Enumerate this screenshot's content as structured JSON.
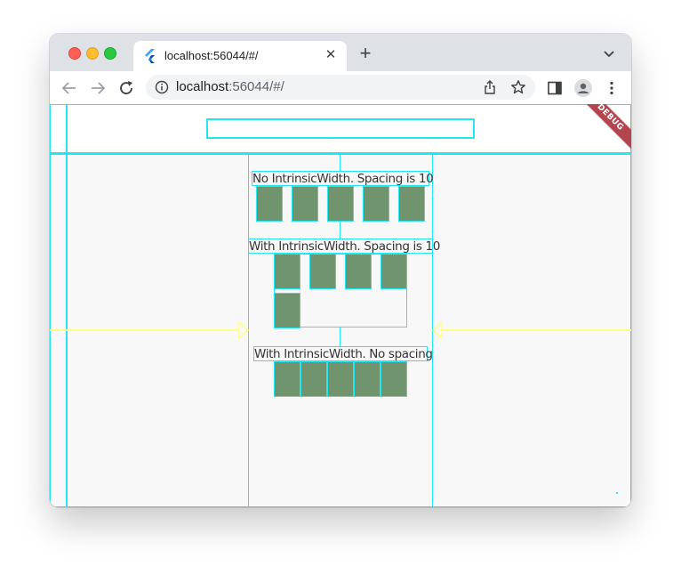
{
  "browser": {
    "tab_title": "localhost:56044/#/",
    "tab_close_glyph": "✕",
    "new_tab_glyph": "+",
    "url_host": "localhost",
    "url_path": ":56044/#/",
    "icons": [
      "back-arrow-icon",
      "forward-arrow-icon",
      "reload-icon",
      "info-icon",
      "share-icon",
      "star-icon",
      "sidebar-icon",
      "profile-icon",
      "more-vert-icon",
      "tab-search-chevron-icon",
      "flutter-logo-icon"
    ]
  },
  "app": {
    "debug_banner": "DEBUG",
    "sections": [
      {
        "label": "No IntrinsicWidth. Spacing is 10",
        "box_count": 5
      },
      {
        "label": "With IntrinsicWidth. Spacing is 10",
        "box_count": 5
      },
      {
        "label": "With IntrinsicWidth. No spacing",
        "box_count": 5
      }
    ],
    "colors": {
      "box_fill": "#6f946e",
      "outline": "#24e6f2",
      "arrow": "#ffff88",
      "debug_banner": "#b4444e"
    }
  }
}
